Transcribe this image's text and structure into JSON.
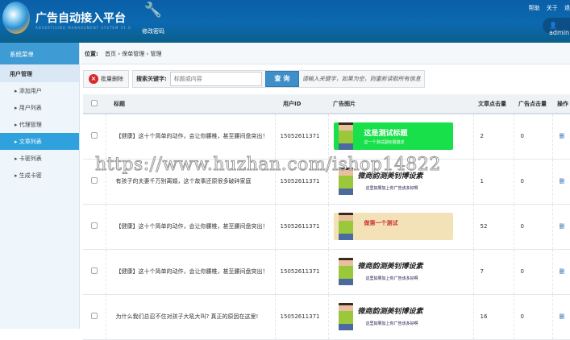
{
  "header": {
    "title": "广告自动接入平台",
    "subtitle": "ADVERTISING MANAGEMENT SYSTEM V1.0",
    "tool_label": "修改密码",
    "help": "帮助",
    "about": "关于",
    "exit": "退",
    "user": "admin"
  },
  "sidebar": {
    "title": "系统菜单",
    "group": "用户管理",
    "items": [
      {
        "label": "添加用户"
      },
      {
        "label": "用户列表"
      },
      {
        "label": "代理管理"
      },
      {
        "label": "文章列表"
      },
      {
        "label": "卡密列表"
      },
      {
        "label": "生成卡密"
      }
    ]
  },
  "breadcrumb": {
    "label": "位置:",
    "items": [
      "首页",
      "保单管理",
      "管理"
    ]
  },
  "toolbar": {
    "batch_delete": "批量删除",
    "search_label": "搜索关键字:",
    "search_placeholder": "标题或内容",
    "search_value": "",
    "query": "查 询",
    "hint": "请输入关键字，如果为空，则重新读取所有信息"
  },
  "table": {
    "headers": [
      "标题",
      "用户ID",
      "广告图片",
      "文章点击量",
      "广告点击量",
      "操作"
    ],
    "rows": [
      {
        "title": "【健康】这十个简单的动作，会让你腰椎，甚至腰间盘突出！",
        "user_id": "15052611371",
        "ad": {
          "style": "g",
          "t1": "这是测试标题",
          "t2": "这一个测试副标题描述"
        },
        "article_clicks": "2",
        "ad_clicks": "0",
        "op": "删"
      },
      {
        "title": "有孩子的夫妻千万别离婚，这个故事还原很多破碎家庭",
        "user_id": "15052611371",
        "ad": {
          "style": "g2",
          "t1": "微商韵测美钊博设素",
          "t2": "这里如果加上你广告该多好啊"
        },
        "article_clicks": "1",
        "ad_clicks": "0",
        "op": "删"
      },
      {
        "title": "【健康】这十个简单的动作，会让你腰椎，甚至腰间盘突出！",
        "user_id": "15052611371",
        "ad": {
          "style": "y",
          "t1": "做第一个测试",
          "t2": ""
        },
        "article_clicks": "52",
        "ad_clicks": "0",
        "op": "删"
      },
      {
        "title": "【健康】这十个简单的动作，会让你腰椎，甚至腰间盘突出！",
        "user_id": "15052611371",
        "ad": {
          "style": "g2",
          "t1": "微商韵测美钊博设素",
          "t2": "这里如果加上你广告该多好啊"
        },
        "article_clicks": "7",
        "ad_clicks": "0",
        "op": "删"
      },
      {
        "title": "为什么我们总忍不住对孩子大吼大叫? 真正的原因在这里!",
        "user_id": "15052611371",
        "ad": {
          "style": "g2",
          "t1": "微商韵测美钊博设素",
          "t2": "这里如果加上你广告该多好啊"
        },
        "article_clicks": "16",
        "ad_clicks": "0",
        "op": "删"
      }
    ]
  },
  "watermark": "https://www.huzhan.com/ishop14822"
}
